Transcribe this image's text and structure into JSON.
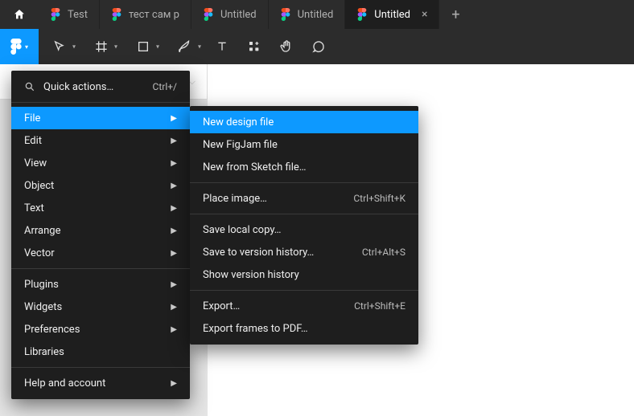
{
  "tabbar": {
    "tabs": [
      {
        "label": "Test"
      },
      {
        "label": "тест сам р"
      },
      {
        "label": "Untitled"
      },
      {
        "label": "Untitled"
      },
      {
        "label": "Untitled",
        "active": true
      }
    ]
  },
  "toolbar": {
    "tools": [
      "move",
      "frame",
      "rectangle",
      "pen",
      "text",
      "resources",
      "hand",
      "comment"
    ]
  },
  "panel_stub_caret": "⌵",
  "main_menu": {
    "quick_actions": {
      "label": "Quick actions…",
      "shortcut": "Ctrl+/"
    },
    "items_top": [
      {
        "id": "file",
        "label": "File",
        "submenu": true,
        "highlight": true
      },
      {
        "id": "edit",
        "label": "Edit",
        "submenu": true
      },
      {
        "id": "view",
        "label": "View",
        "submenu": true
      },
      {
        "id": "object",
        "label": "Object",
        "submenu": true
      },
      {
        "id": "text",
        "label": "Text",
        "submenu": true
      },
      {
        "id": "arrange",
        "label": "Arrange",
        "submenu": true
      },
      {
        "id": "vector",
        "label": "Vector",
        "submenu": true
      }
    ],
    "items_mid": [
      {
        "id": "plugins",
        "label": "Plugins",
        "submenu": true
      },
      {
        "id": "widgets",
        "label": "Widgets",
        "submenu": true
      },
      {
        "id": "preferences",
        "label": "Preferences",
        "submenu": true
      },
      {
        "id": "libraries",
        "label": "Libraries",
        "submenu": false
      }
    ],
    "items_bottom": [
      {
        "id": "help",
        "label": "Help and account",
        "submenu": true
      }
    ]
  },
  "sub_menu": {
    "sections": [
      [
        {
          "id": "new-design",
          "label": "New design file",
          "highlight": true
        },
        {
          "id": "new-figjam",
          "label": "New FigJam file"
        },
        {
          "id": "new-sketch",
          "label": "New from Sketch file…"
        }
      ],
      [
        {
          "id": "place-image",
          "label": "Place image…",
          "shortcut": "Ctrl+Shift+K"
        }
      ],
      [
        {
          "id": "save-local",
          "label": "Save local copy…"
        },
        {
          "id": "save-version",
          "label": "Save to version history…",
          "shortcut": "Ctrl+Alt+S"
        },
        {
          "id": "show-history",
          "label": "Show version history"
        }
      ],
      [
        {
          "id": "export",
          "label": "Export…",
          "shortcut": "Ctrl+Shift+E"
        },
        {
          "id": "export-pdf",
          "label": "Export frames to PDF…"
        }
      ]
    ]
  },
  "colors": {
    "accent": "#0d99ff"
  }
}
